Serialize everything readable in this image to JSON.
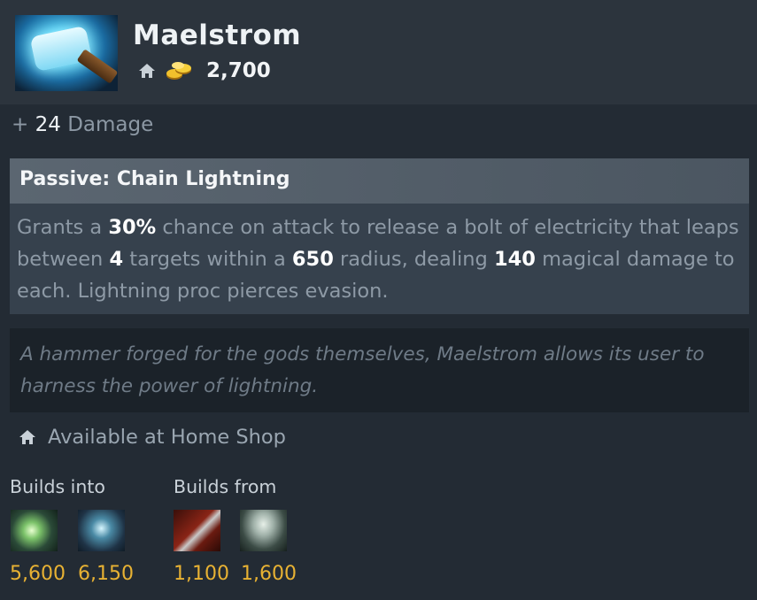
{
  "item": {
    "name": "Maelstrom",
    "cost": "2,700",
    "icon": "maelstrom-hammer-icon"
  },
  "bonus": {
    "sign": "+",
    "value": "24",
    "stat": "Damage"
  },
  "passive": {
    "title": "Passive: Chain Lightning",
    "desc": {
      "t1": "Grants a ",
      "chance": "30%",
      "t2": " chance on attack to release a bolt of electricity that leaps between ",
      "targets": "4",
      "t3": " targets within a ",
      "radius": "650",
      "t4": " radius, dealing ",
      "damage": "140",
      "t5": " magical damage to each. Lightning proc pierces evasion."
    }
  },
  "lore": "A hammer forged for the gods themselves, Maelstrom allows its user to harness the power of lightning.",
  "availability": {
    "text": "Available at Home Shop",
    "icon": "home-icon"
  },
  "builds_into": {
    "label": "Builds into",
    "items": [
      {
        "icon": "mjollnir-icon",
        "price": "5,600"
      },
      {
        "icon": "gleipnir-icon",
        "price": "6,150"
      }
    ]
  },
  "builds_from": {
    "label": "Builds from",
    "items": [
      {
        "icon": "javelin-icon",
        "price": "1,100"
      },
      {
        "icon": "mithril-hammer-icon",
        "price": "1,600"
      }
    ]
  },
  "colors": {
    "gold": "#e8b233",
    "background": "#232b34",
    "header": "#2c343d",
    "passive_panel": "#36414d"
  }
}
